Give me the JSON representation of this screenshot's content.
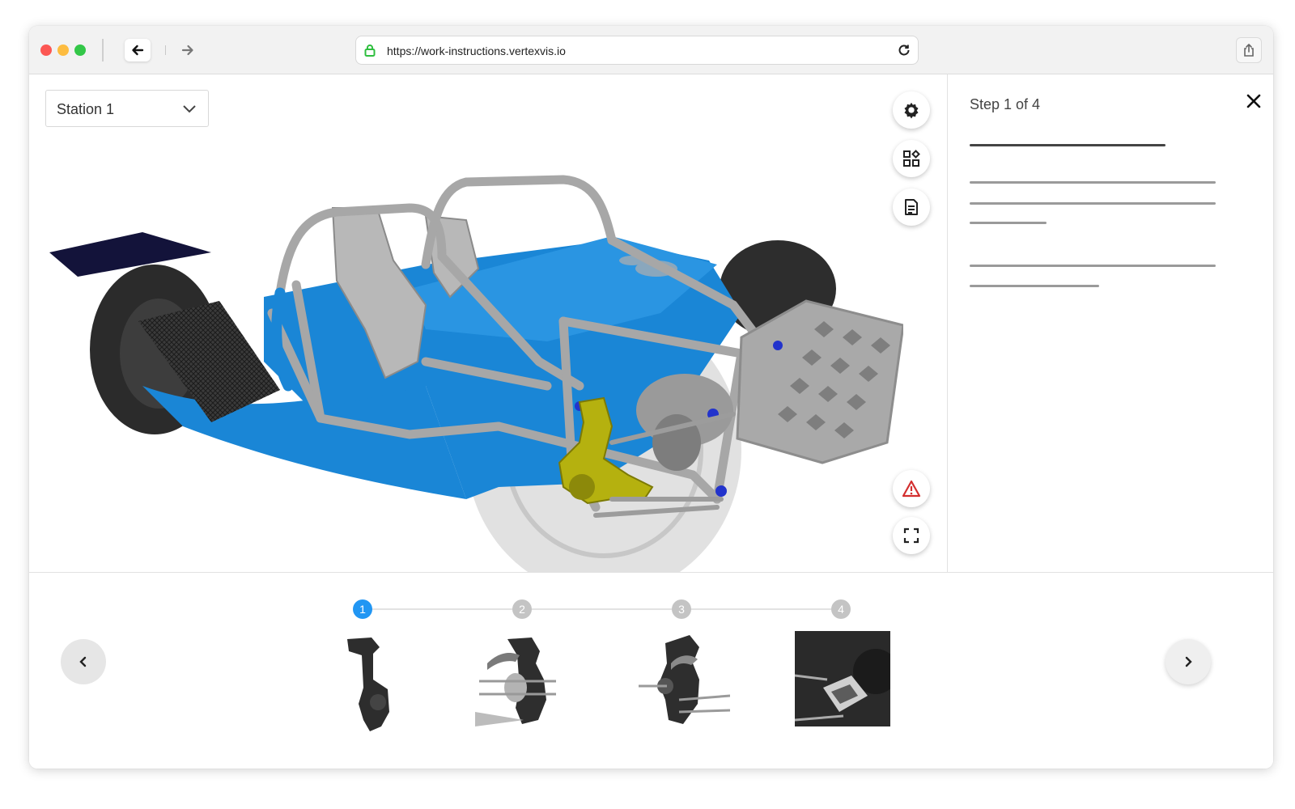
{
  "browser": {
    "url": "https://work-instructions.vertexvis.io"
  },
  "viewer": {
    "station_label": "Station 1"
  },
  "panel": {
    "step_title": "Step 1 of 4"
  },
  "steps": [
    {
      "number": "1",
      "active": true
    },
    {
      "number": "2",
      "active": false
    },
    {
      "number": "3",
      "active": false
    },
    {
      "number": "4",
      "active": false
    }
  ],
  "icons": {
    "back": "arrow-left-icon",
    "forward": "arrow-right-icon",
    "lock": "lock-icon",
    "reload": "reload-icon",
    "share": "share-icon",
    "dropdown": "chevron-down-icon",
    "settings": "gear-icon",
    "parts": "grid-shapes-icon",
    "notes": "document-icon",
    "warning": "warning-icon",
    "fullscreen": "expand-icon",
    "close": "close-icon",
    "prev": "chevron-left-icon",
    "next": "chevron-right-icon"
  },
  "colors": {
    "accent": "#2196f3",
    "body_blue": "#1a86d6",
    "frame_gray": "#a7a7a7",
    "highlight_part": "#b5b10f",
    "warning_red": "#d32f2f"
  }
}
